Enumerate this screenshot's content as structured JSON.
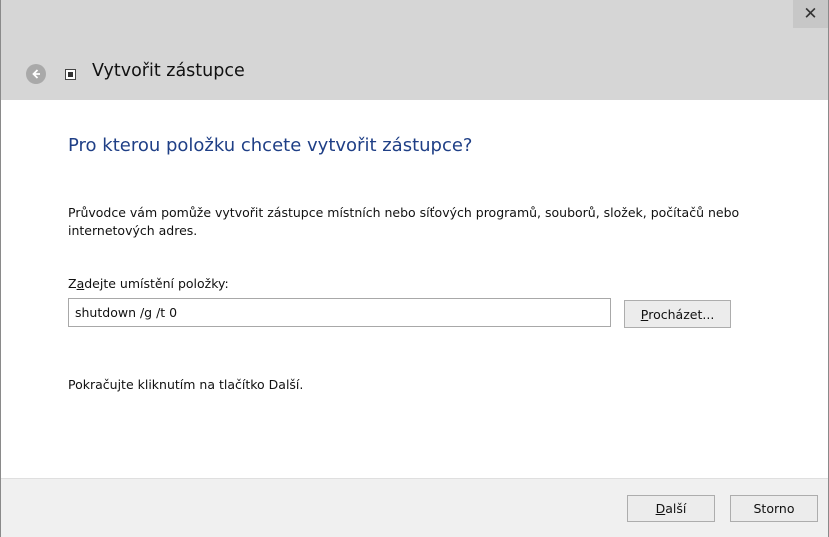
{
  "window": {
    "title": "Vytvořit zástupce",
    "close_symbol": "✕"
  },
  "icons": {
    "back": "back-arrow-icon",
    "wizard": "shortcut-wizard-icon",
    "close": "close-icon"
  },
  "content": {
    "heading": "Pro kterou položku chcete vytvořit zástupce?",
    "description": "Průvodce vám pomůže vytvořit zástupce místních nebo síťových programů, souborů, složek, počítačů nebo internetových adres.",
    "field_label": {
      "pre": "Z",
      "accesskey": "a",
      "post": "dejte umístění položky:"
    },
    "path_value": "shutdown /g /t 0",
    "browse_label": {
      "accesskey": "P",
      "post": "rocházet..."
    },
    "continue_text": "Pokračujte kliknutím na tlačítko Další."
  },
  "footer": {
    "next_label": {
      "accesskey": "D",
      "post": "alší"
    },
    "cancel_label": "Storno"
  }
}
